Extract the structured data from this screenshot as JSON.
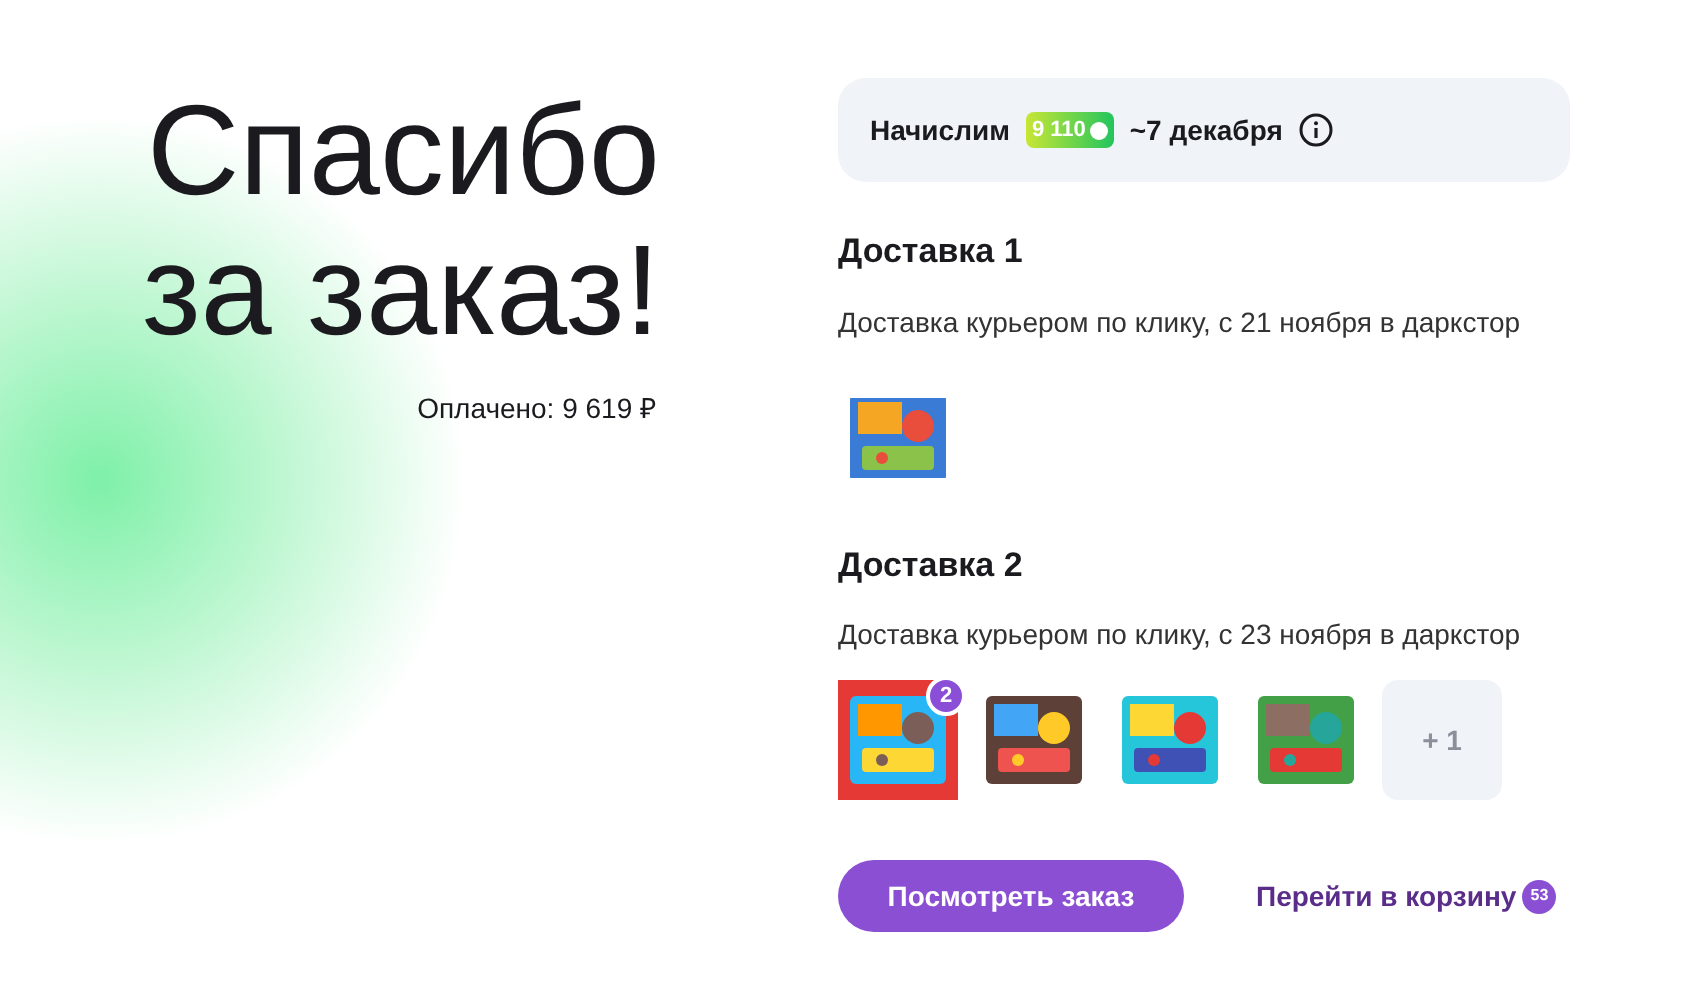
{
  "heading": {
    "line_1": "Спасибо",
    "line_2": "за заказ!"
  },
  "paid": "Оплачено: 9 619 ₽",
  "bonus": {
    "prefix": "Начислим",
    "amount": "9 110",
    "date": "~7 декабря"
  },
  "deliveries": [
    {
      "title": "Доставка 1",
      "description": "Доставка курьером по клику, с 21 ноября в даркстор",
      "items": [
        {
          "kind": "picture"
        }
      ]
    },
    {
      "title": "Доставка 2",
      "description": "Доставка курьером по клику, с 23 ноября в даркстор",
      "items": [
        {
          "kind": "picture",
          "badge": "2"
        },
        {
          "kind": "picture"
        },
        {
          "kind": "picture"
        },
        {
          "kind": "picture"
        },
        {
          "kind": "more",
          "label": "+ 1"
        }
      ]
    }
  ],
  "view_order_button": "Посмотреть заказ",
  "cart_link": {
    "label": "Перейти в корзину",
    "count": "53"
  }
}
